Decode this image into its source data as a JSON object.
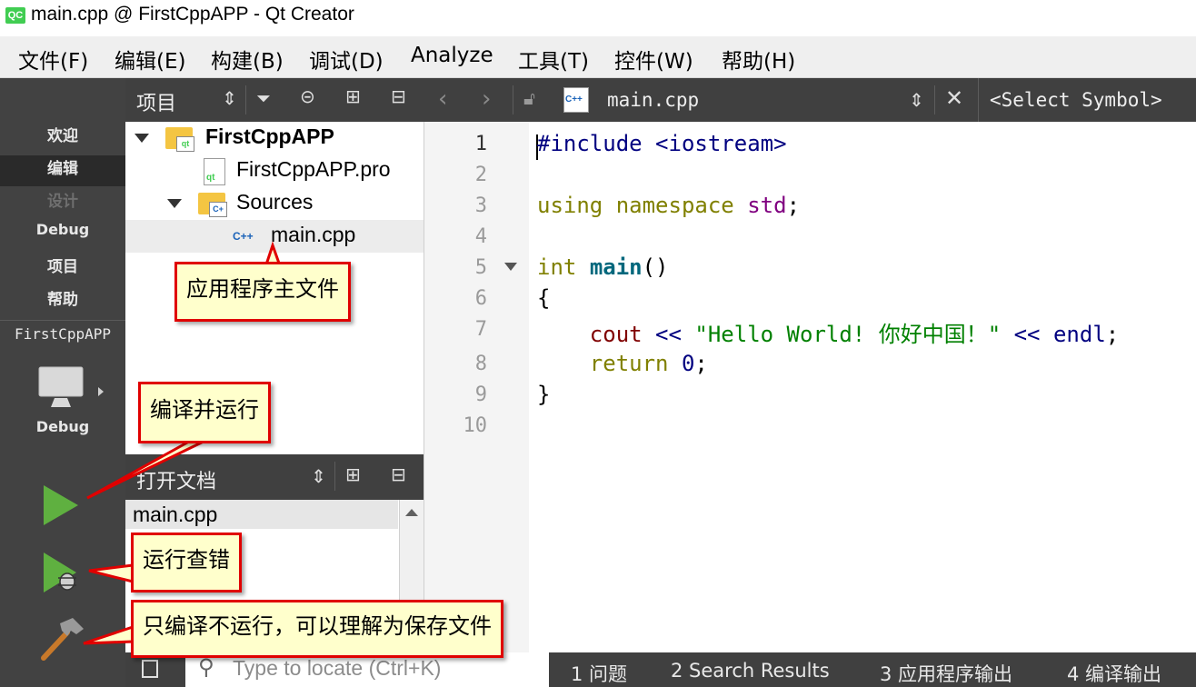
{
  "window": {
    "title": "main.cpp @ FirstCppAPP - Qt Creator",
    "logo": "QC"
  },
  "menu": [
    "文件(F)",
    "编辑(E)",
    "构建(B)",
    "调试(D)",
    "Analyze",
    "工具(T)",
    "控件(W)",
    "帮助(H)"
  ],
  "modes": [
    "欢迎",
    "编辑",
    "设计",
    "Debug",
    "项目",
    "帮助"
  ],
  "kit": {
    "project": "FirstCppAPP",
    "config": "Debug"
  },
  "project_pane": {
    "title": "项目",
    "root": "FirstCppAPP",
    "pro_file": "FirstCppAPP.pro",
    "sources_folder": "Sources",
    "main_file": "main.cpp"
  },
  "open_docs": {
    "title": "打开文档",
    "items": [
      "main.cpp"
    ]
  },
  "editor": {
    "file_name": "main.cpp",
    "symbol": "<Select Symbol>",
    "line_numbers": [
      "1",
      "2",
      "3",
      "4",
      "5",
      "6",
      "7",
      "8",
      "9",
      "10"
    ],
    "current_line": 1
  },
  "status": {
    "locate_placeholder": "Type to locate (Ctrl+K)",
    "tabs": [
      "1  问题",
      "2  Search Results",
      "3  应用程序输出",
      "4  编译输出"
    ]
  },
  "annotations": {
    "main_file": "应用程序主文件",
    "build_run": "编译并运行",
    "debug_run": "运行查错",
    "build_only": "只编译不运行，可以理解为保存文件"
  },
  "icons": [
    "qt-logo-icon",
    "sort-icon",
    "filter-icon",
    "link-icon",
    "split-icon",
    "close-pane-icon",
    "back-icon",
    "forward-icon",
    "lock-icon",
    "cpp-file-icon",
    "close-icon",
    "monitor-icon",
    "run-icon",
    "debug-run-icon",
    "build-hammer-icon",
    "search-icon",
    "sidebar-toggle-icon"
  ],
  "colors": {
    "mode_bar": "#424242",
    "pane_header": "#404040",
    "callout_border": "#e00000",
    "callout_fill": "#ffffcc",
    "run_green": "#5fb040"
  }
}
